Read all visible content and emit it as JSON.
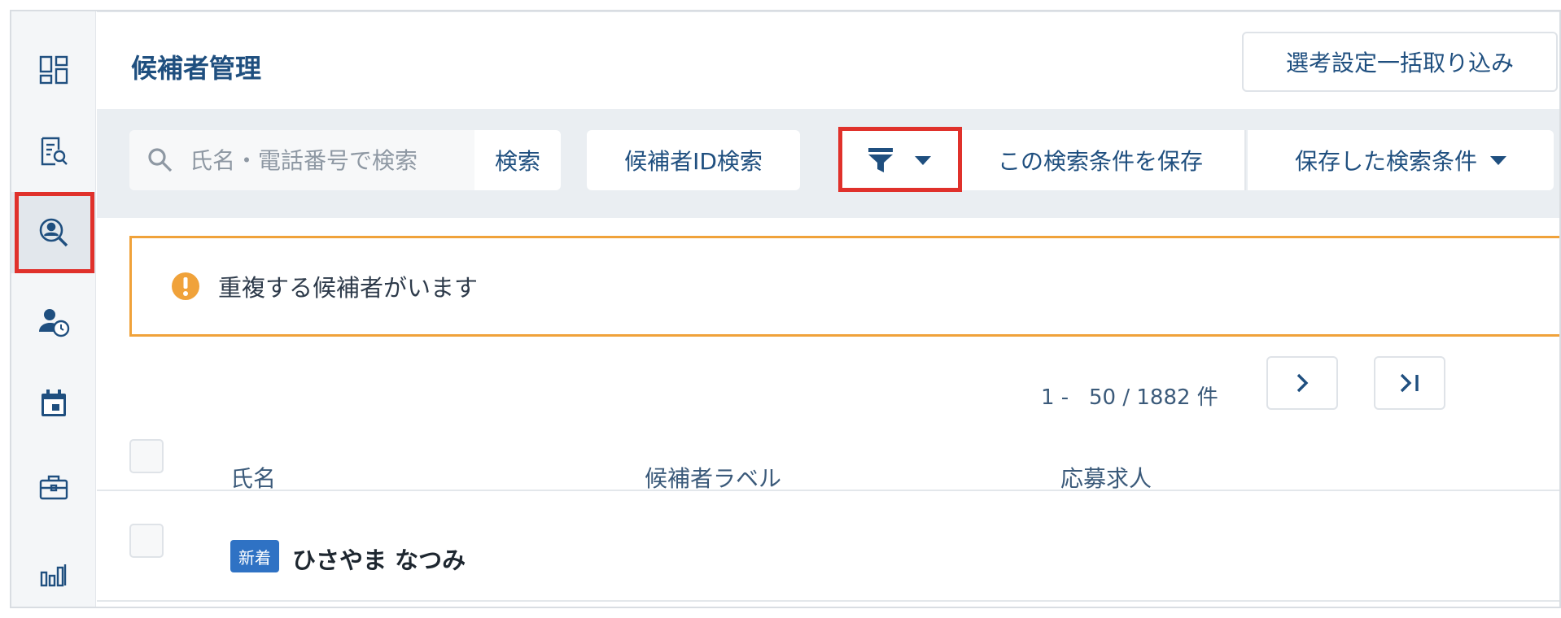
{
  "sidebar": {
    "items": [
      {
        "name": "dashboard",
        "icon": "dashboard-icon"
      },
      {
        "name": "job-search",
        "icon": "document-search-icon"
      },
      {
        "name": "candidates",
        "icon": "user-search-icon",
        "active": true
      },
      {
        "name": "schedule-users",
        "icon": "user-clock-icon"
      },
      {
        "name": "calendar",
        "icon": "calendar-icon"
      },
      {
        "name": "jobs",
        "icon": "briefcase-icon"
      },
      {
        "name": "reports",
        "icon": "bar-chart-icon"
      }
    ]
  },
  "header": {
    "title": "候補者管理",
    "import_button": "選考設定一括取り込み"
  },
  "toolbar": {
    "search_placeholder": "氏名・電話番号で検索",
    "search_button": "検索",
    "id_search_button": "候補者ID検索",
    "filter_icon": "filter-icon",
    "save_condition_button": "この検索条件を保存",
    "saved_conditions_button": "保存した検索条件"
  },
  "alert": {
    "text": "重複する候補者がいます",
    "icon": "warning-icon",
    "color": "#f0a23a"
  },
  "pagination": {
    "text": "1 -   50 / 1882 件",
    "next_icon": "chevron-right-icon",
    "last_icon": "last-page-icon"
  },
  "table": {
    "columns": [
      "氏名",
      "候補者ラベル",
      "応募求人"
    ],
    "rows": [
      {
        "badge": "新着",
        "name": "ひさやま なつみ",
        "label": "",
        "job": ""
      }
    ]
  },
  "colors": {
    "accent": "#1f4f7f",
    "highlight": "#e0312b",
    "badge": "#2f72c4"
  }
}
